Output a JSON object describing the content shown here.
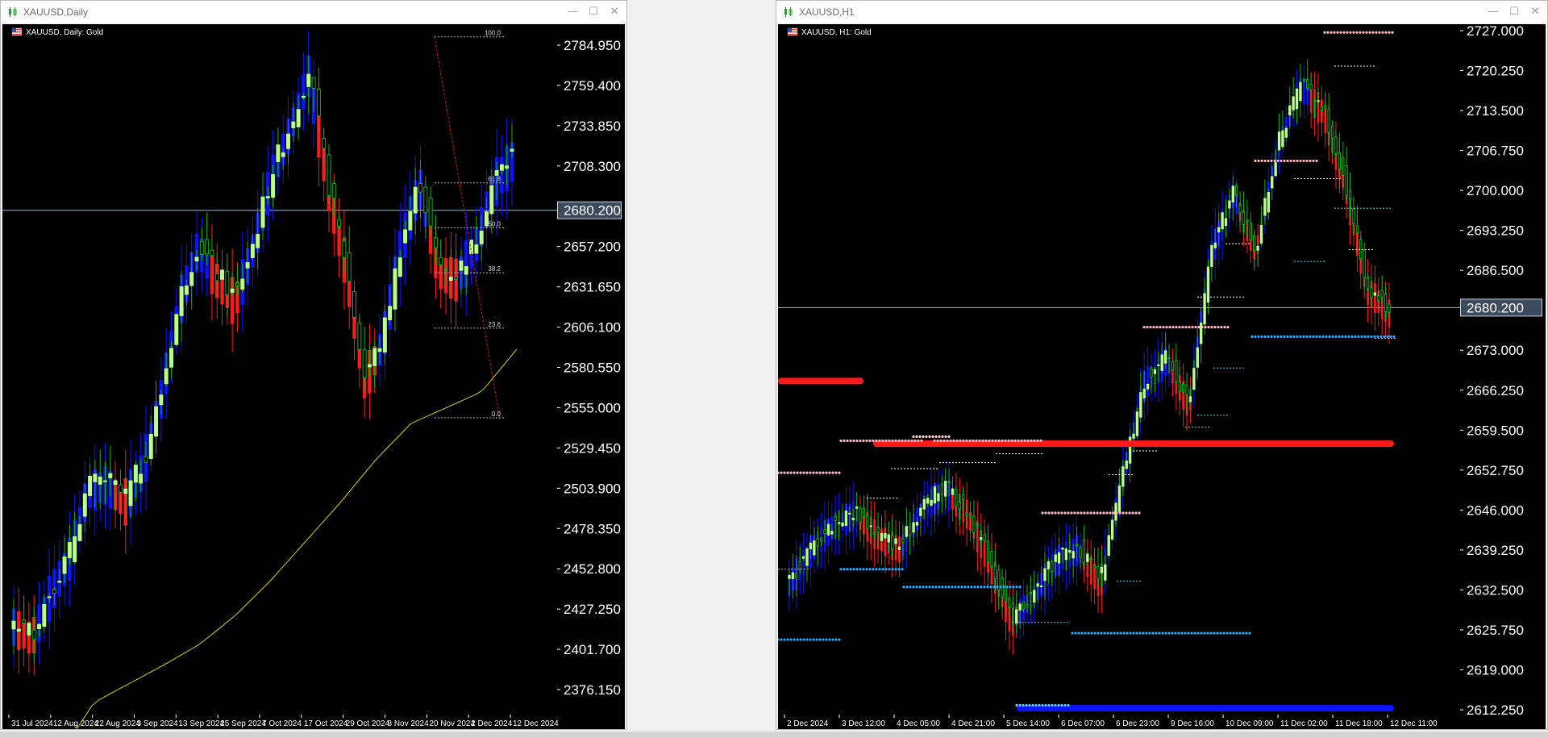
{
  "colors": {
    "bg": "#000000",
    "bull": "#b8ff8c",
    "bear": "#0bb80b",
    "grid_text": "#ffffff",
    "trend_up": "#0a14ff",
    "trend_down": "#ff1a1a",
    "ma": "#d4d400",
    "res": "#ffb8c6",
    "sup": "#2ea9ff",
    "cur": "#9fb3c8",
    "axis_label_bg": "#3c4b5c"
  },
  "left": {
    "title": "XAUUSD,Daily",
    "label": "XAUUSD, Daily:  Gold",
    "price_labels": [
      "2784.950",
      "2759.400",
      "2733.850",
      "2708.300",
      "2657.200",
      "2631.650",
      "2606.100",
      "2580.550",
      "2555.000",
      "2529.450",
      "2503.900",
      "2478.350",
      "2452.800",
      "2427.250",
      "2401.700",
      "2376.150"
    ],
    "current_price": "2680.200",
    "date_labels": [
      "31 Jul 2024",
      "12 Aug 2024",
      "22 Aug 2024",
      "3 Sep 2024",
      "13 Sep 2024",
      "25 Sep 2024",
      "7 Oct 2024",
      "17 Oct 2024",
      "29 Oct 2024",
      "8 Nov 2024",
      "20 Nov 2024",
      "2 Dec 2024",
      "12 Dec 2024"
    ],
    "fib_levels": [
      {
        "label": "100.0",
        "price": 2790.2
      },
      {
        "label": "61.8",
        "price": 2697.6
      },
      {
        "label": "50.0",
        "price": 2669.1
      },
      {
        "label": "38.2",
        "price": 2640.6
      },
      {
        "label": "23.6",
        "price": 2605.4
      },
      {
        "label": "0.0",
        "price": 2548.6
      }
    ]
  },
  "right": {
    "title": "XAUUSD,H1",
    "label": "XAUUSD, H1:  Gold",
    "price_labels": [
      "2727.000",
      "2720.250",
      "2713.500",
      "2706.750",
      "2700.000",
      "2693.250",
      "2686.500",
      "2673.000",
      "2666.250",
      "2659.500",
      "2652.750",
      "2646.000",
      "2639.250",
      "2632.500",
      "2625.750",
      "2619.000",
      "2612.250"
    ],
    "current_price": "2680.200",
    "date_labels": [
      "2 Dec 2024",
      "3 Dec 12:00",
      "4 Dec 05:00",
      "4 Dec 21:00",
      "5 Dec 14:00",
      "6 Dec 07:00",
      "6 Dec 23:00",
      "9 Dec 16:00",
      "10 Dec 09:00",
      "11 Dec 02:00",
      "11 Dec 18:00",
      "12 Dec 11:00"
    ]
  },
  "icons": {
    "window": "chart-window-icon",
    "flag": "us-flag-icon",
    "min": "minimize-icon",
    "max": "maximize-icon",
    "close": "close-icon"
  },
  "window_buttons": {
    "min": "—",
    "max": "☐",
    "close": "✕"
  }
}
